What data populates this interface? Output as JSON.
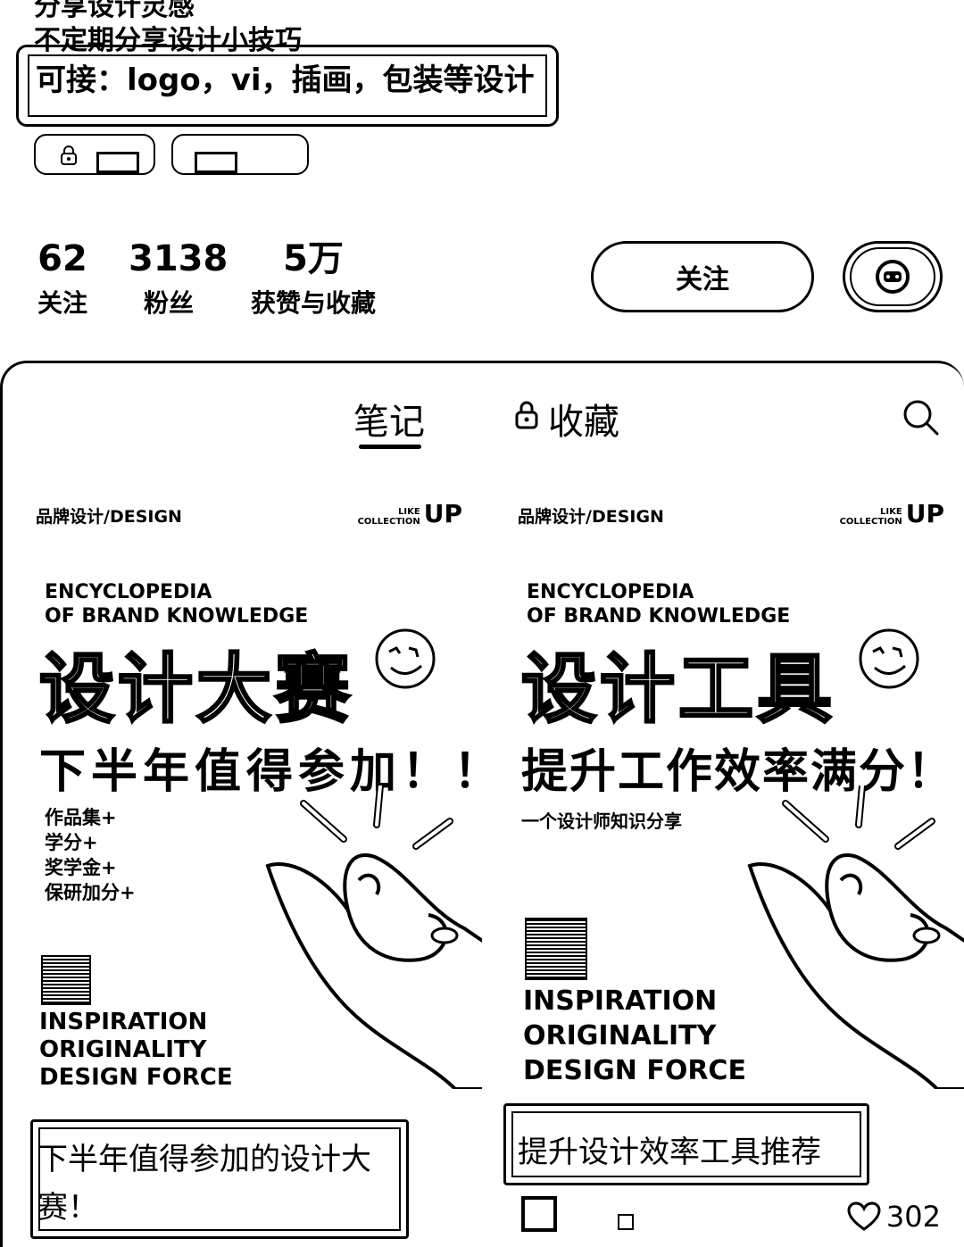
{
  "profile": {
    "bio_cut": "分享设计灵感",
    "bio_line2": "不定期分享设计小技巧",
    "bio_line3": "可接：logo，vi，插画，包装等设计"
  },
  "stats": {
    "following_count": "62",
    "following_label": "关注",
    "followers_count": "3138",
    "followers_label": "粉丝",
    "likes_count": "5万",
    "likes_label": "获赞与收藏"
  },
  "actions": {
    "follow_label": "关注",
    "chat_icon": "chat-bubble-icon"
  },
  "tabs": [
    {
      "label": "笔记",
      "active": true
    },
    {
      "label": "收藏",
      "locked": true
    }
  ],
  "notes": [
    {
      "cover": {
        "brand": "品牌设计/DESIGN",
        "logo_like": "LIKE",
        "logo_collection": "COLLECTION",
        "logo_up": "UP",
        "en_line1": "ENCYCLOPEDIA",
        "en_line2": "OF BRAND KNOWLEDGE",
        "headline": "设计大赛",
        "subheadline": "下半年值得参加！！",
        "points": [
          "作品集+",
          "学分+",
          "奖学金+",
          "保研加分+"
        ],
        "insp_1": "INSPIRATION",
        "insp_2": "ORIGINALITY",
        "insp_3": "DESIGN FORCE"
      },
      "title": "下半年值得参加的设计大赛！"
    },
    {
      "cover": {
        "brand": "品牌设计/DESIGN",
        "logo_like": "LIKE",
        "logo_collection": "COLLECTION",
        "logo_up": "UP",
        "en_line1": "ENCYCLOPEDIA",
        "en_line2": "OF BRAND KNOWLEDGE",
        "headline": "设计工具",
        "subheadline": "提升工作效率满分！",
        "sub": "一个设计师知识分享",
        "insp_1": "INSPIRATION",
        "insp_2": "ORIGINALITY",
        "insp_3": "DESIGN FORCE"
      },
      "title": "提升设计效率工具推荐",
      "likes": "302"
    }
  ]
}
